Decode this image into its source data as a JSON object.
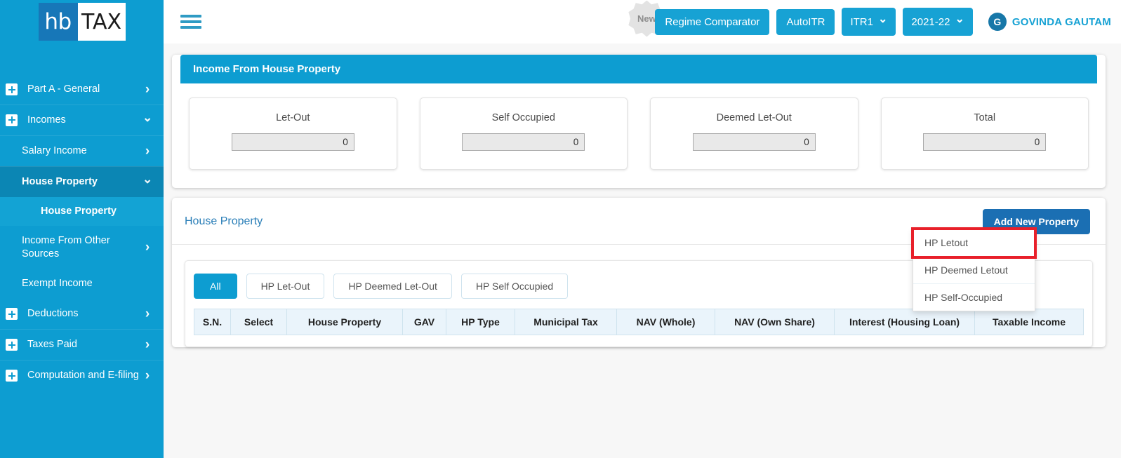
{
  "brand": {
    "logo_left": "hb",
    "logo_right": "TAX"
  },
  "sidebar": {
    "items": [
      {
        "label": "Part A - General",
        "icon": "plus-square-icon",
        "chevron": "right"
      },
      {
        "label": "Incomes",
        "icon": "plus-square-icon",
        "chevron": "down"
      }
    ],
    "sub_items": [
      {
        "label": "Salary Income",
        "chevron": "right",
        "active": false
      },
      {
        "label": "House Property",
        "chevron": "down",
        "active": true
      }
    ],
    "leaf_items": [
      {
        "label": "House Property",
        "selected": true
      }
    ],
    "sub_items2": [
      {
        "label": "Income From Other Sources",
        "chevron": "right"
      },
      {
        "label": "Exempt Income",
        "chevron": ""
      }
    ],
    "items2": [
      {
        "label": "Deductions",
        "icon": "plus-square-icon",
        "chevron": "right"
      },
      {
        "label": "Taxes Paid",
        "icon": "plus-square-icon",
        "chevron": "right"
      },
      {
        "label": "Computation and E-filing",
        "icon": "plus-square-icon",
        "chevron": "right"
      }
    ]
  },
  "topbar": {
    "menu_icon": "hamburger-icon",
    "new_badge": "New",
    "regime_comparator": "Regime Comparator",
    "auto_itr": "AutoITR",
    "itr_select": "ITR1",
    "year_select": "2021-22",
    "avatar_initial": "G",
    "user_name": "GOVINDA GAUTAM"
  },
  "income_panel": {
    "title": "Income From House Property",
    "cards": [
      {
        "label": "Let-Out",
        "value": "0"
      },
      {
        "label": "Self Occupied",
        "value": "0"
      },
      {
        "label": "Deemed Let-Out",
        "value": "0"
      },
      {
        "label": "Total",
        "value": "0"
      }
    ]
  },
  "hp_panel": {
    "title": "House Property",
    "add_button": "Add New Property",
    "dropdown": {
      "items": [
        {
          "label": "HP Letout",
          "highlighted": true
        },
        {
          "label": "HP Deemed Letout",
          "highlighted": false
        },
        {
          "label": "HP Self-Occupied",
          "highlighted": false
        }
      ]
    },
    "filters": [
      {
        "label": "All",
        "active": true
      },
      {
        "label": "HP Let-Out",
        "active": false
      },
      {
        "label": "HP Deemed Let-Out",
        "active": false
      },
      {
        "label": "HP Self Occupied",
        "active": false
      }
    ],
    "table": {
      "columns": [
        "S.N.",
        "Select",
        "House Property",
        "GAV",
        "HP Type",
        "Municipal Tax",
        "NAV (Whole)",
        "NAV (Own Share)",
        "Interest (Housing Loan)",
        "Taxable Income"
      ],
      "rows": []
    }
  },
  "colors": {
    "sidebar": "#0d9dd1",
    "sidebar_active": "#0b86b4",
    "accent": "#17a2d4",
    "primary_button": "#1b6fb3",
    "highlight_red": "#e8202a",
    "table_header": "#eaf4fb",
    "page_background": "#f7f7f7"
  }
}
